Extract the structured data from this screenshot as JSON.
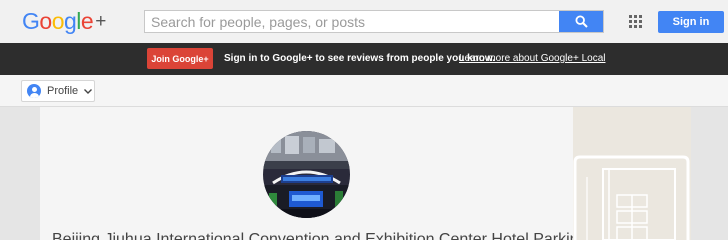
{
  "header": {
    "logo": {
      "g1": "G",
      "o1": "o",
      "o2": "o",
      "g2": "g",
      "l": "l",
      "e": "e",
      "plus": "+"
    },
    "search": {
      "placeholder": "Search for people, pages, or posts",
      "value": ""
    },
    "signin_label": "Sign in",
    "icons": {
      "search": "search-icon",
      "apps": "apps-grid-icon"
    }
  },
  "promo": {
    "join_label": "Join Google+",
    "message": "Sign in to Google+ to see reviews from people you know.",
    "link": "Learn more about Google+ Local"
  },
  "profile_bar": {
    "button_label": "Profile",
    "icons": {
      "avatar": "profile-avatar-icon",
      "dropdown": "chevron-down-icon"
    }
  },
  "place": {
    "title": "Beijing Jiuhua International Convention and Exhibition Center Hotel Parking Lot"
  },
  "colors": {
    "accent_blue": "#4285f4",
    "join_red": "#db4437",
    "promo_bar": "#2d2d2d",
    "page_bg": "#e5e5e5"
  }
}
